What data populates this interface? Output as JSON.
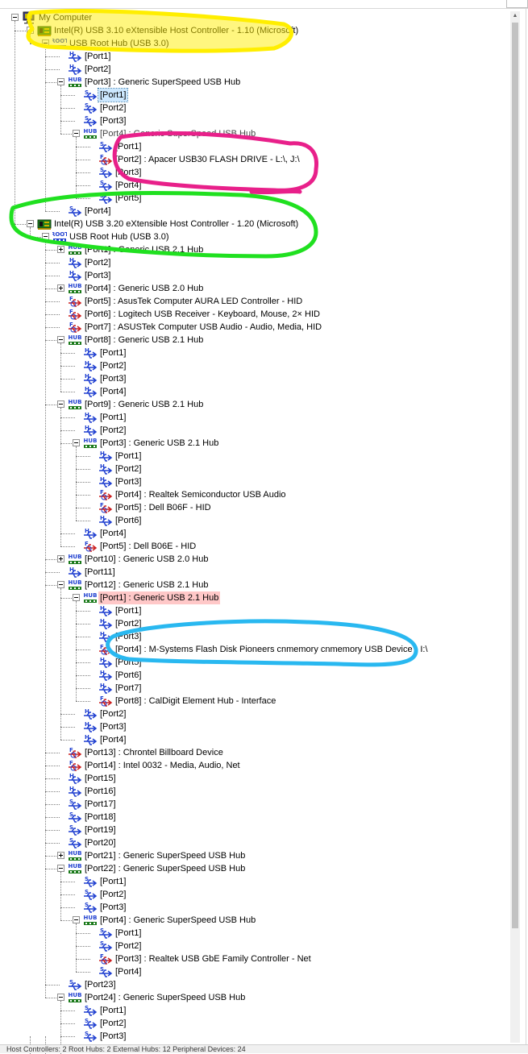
{
  "tree": [
    {
      "depth": 0,
      "exp": "minus",
      "icon": "computer",
      "label": "My Computer"
    },
    {
      "depth": 1,
      "exp": "minus",
      "icon": "controller",
      "label": "Intel(R) USB 3.10 eXtensible Host Controller - 1.10 (Microsoft)"
    },
    {
      "depth": 2,
      "exp": "minus",
      "icon": "root",
      "label": "USB Root Hub (USB 3.0)"
    },
    {
      "depth": 3,
      "icon": "usb2",
      "label": "[Port1]"
    },
    {
      "depth": 3,
      "icon": "usb2",
      "label": "[Port2]"
    },
    {
      "depth": 3,
      "exp": "minus",
      "icon": "hub",
      "label": "[Port3] : Generic SuperSpeed USB Hub"
    },
    {
      "depth": 4,
      "icon": "ss",
      "label": "[Port1]",
      "state": "selected"
    },
    {
      "depth": 4,
      "icon": "ss",
      "label": "[Port2]"
    },
    {
      "depth": 4,
      "icon": "ss",
      "label": "[Port3]"
    },
    {
      "depth": 4,
      "exp": "minus",
      "icon": "hub",
      "label": "[Port4] : Generic SuperSpeed USB Hub",
      "state": "faint"
    },
    {
      "depth": 5,
      "icon": "ss",
      "label": "[Port1]"
    },
    {
      "depth": 5,
      "icon": "dev",
      "label": "[Port2] : Apacer USB30 FLASH DRIVE - L:\\, J:\\"
    },
    {
      "depth": 5,
      "icon": "ss",
      "label": "[Port3]"
    },
    {
      "depth": 5,
      "icon": "ss",
      "label": "[Port4]"
    },
    {
      "depth": 5,
      "icon": "ss",
      "label": "[Port5]"
    },
    {
      "depth": 3,
      "icon": "ss",
      "label": "[Port4]"
    },
    {
      "depth": 1,
      "exp": "minus",
      "icon": "controller",
      "label": "Intel(R) USB 3.20 eXtensible Host Controller - 1.20 (Microsoft)"
    },
    {
      "depth": 2,
      "exp": "minus",
      "icon": "root",
      "label": "USB Root Hub (USB 3.0)"
    },
    {
      "depth": 3,
      "exp": "plus",
      "icon": "hub",
      "label": "[Port1] : Generic USB 2.1 Hub"
    },
    {
      "depth": 3,
      "icon": "usb2",
      "label": "[Port2]"
    },
    {
      "depth": 3,
      "icon": "usb2",
      "label": "[Port3]"
    },
    {
      "depth": 3,
      "exp": "plus",
      "icon": "hub",
      "label": "[Port4] : Generic USB 2.0 Hub"
    },
    {
      "depth": 3,
      "icon": "dev",
      "label": "[Port5] : AsusTek Computer AURA LED Controller - HID"
    },
    {
      "depth": 3,
      "icon": "dev",
      "label": "[Port6] : Logitech USB Receiver - Keyboard, Mouse, 2× HID"
    },
    {
      "depth": 3,
      "icon": "dev",
      "label": "[Port7] : ASUSTek Computer USB Audio - Audio, Media, HID"
    },
    {
      "depth": 3,
      "exp": "minus",
      "icon": "hub",
      "label": "[Port8] : Generic USB 2.1 Hub"
    },
    {
      "depth": 4,
      "icon": "usb2",
      "label": "[Port1]"
    },
    {
      "depth": 4,
      "icon": "usb2",
      "label": "[Port2]"
    },
    {
      "depth": 4,
      "icon": "usb2",
      "label": "[Port3]"
    },
    {
      "depth": 4,
      "icon": "usb2",
      "label": "[Port4]"
    },
    {
      "depth": 3,
      "exp": "minus",
      "icon": "hub",
      "label": "[Port9] : Generic USB 2.1 Hub"
    },
    {
      "depth": 4,
      "icon": "usb2",
      "label": "[Port1]"
    },
    {
      "depth": 4,
      "icon": "usb2",
      "label": "[Port2]"
    },
    {
      "depth": 4,
      "exp": "minus",
      "icon": "hub",
      "label": "[Port3] : Generic USB 2.1 Hub"
    },
    {
      "depth": 5,
      "icon": "usb2",
      "label": "[Port1]"
    },
    {
      "depth": 5,
      "icon": "usb2",
      "label": "[Port2]"
    },
    {
      "depth": 5,
      "icon": "usb2",
      "label": "[Port3]"
    },
    {
      "depth": 5,
      "icon": "dev",
      "label": "[Port4] : Realtek Semiconductor USB Audio"
    },
    {
      "depth": 5,
      "icon": "dev",
      "label": "[Port5] : Dell B06F - HID"
    },
    {
      "depth": 5,
      "icon": "usb2",
      "label": "[Port6]"
    },
    {
      "depth": 4,
      "icon": "usb2",
      "label": "[Port4]"
    },
    {
      "depth": 4,
      "icon": "dev",
      "label": "[Port5] : Dell B06E - HID"
    },
    {
      "depth": 3,
      "exp": "plus",
      "icon": "hub",
      "label": "[Port10] : Generic USB 2.0 Hub"
    },
    {
      "depth": 3,
      "icon": "usb2",
      "label": "[Port11]"
    },
    {
      "depth": 3,
      "exp": "minus",
      "icon": "hub",
      "label": "[Port12] : Generic USB 2.1 Hub"
    },
    {
      "depth": 4,
      "exp": "minus",
      "icon": "hub",
      "label": "[Port1] : Generic USB 2.1 Hub",
      "state": "highlight"
    },
    {
      "depth": 5,
      "icon": "usb2",
      "label": "[Port1]"
    },
    {
      "depth": 5,
      "icon": "usb2",
      "label": "[Port2]"
    },
    {
      "depth": 5,
      "icon": "usb2",
      "label": "[Port3]"
    },
    {
      "depth": 5,
      "icon": "dev",
      "label": "[Port4] : M-Systems Flash Disk Pioneers cnmemory cnmemory USB Device - I:\\"
    },
    {
      "depth": 5,
      "icon": "usb2",
      "label": "[Port5]"
    },
    {
      "depth": 5,
      "icon": "usb2",
      "label": "[Port6]"
    },
    {
      "depth": 5,
      "icon": "usb2",
      "label": "[Port7]"
    },
    {
      "depth": 5,
      "icon": "dev",
      "label": "[Port8] : CalDigit Element Hub -  Interface"
    },
    {
      "depth": 4,
      "icon": "usb2",
      "label": "[Port2]"
    },
    {
      "depth": 4,
      "icon": "usb2",
      "label": "[Port3]"
    },
    {
      "depth": 4,
      "icon": "usb2",
      "label": "[Port4]"
    },
    {
      "depth": 3,
      "icon": "dev",
      "label": "[Port13] : Chrontel Billboard Device"
    },
    {
      "depth": 3,
      "icon": "dev",
      "label": "[Port14] : Intel 0032 - Media, Audio, Net"
    },
    {
      "depth": 3,
      "icon": "usb2",
      "label": "[Port15]"
    },
    {
      "depth": 3,
      "icon": "usb2",
      "label": "[Port16]"
    },
    {
      "depth": 3,
      "icon": "ss",
      "label": "[Port17]"
    },
    {
      "depth": 3,
      "icon": "ss",
      "label": "[Port18]"
    },
    {
      "depth": 3,
      "icon": "ss",
      "label": "[Port19]"
    },
    {
      "depth": 3,
      "icon": "ss",
      "label": "[Port20]"
    },
    {
      "depth": 3,
      "exp": "plus",
      "icon": "hub",
      "label": "[Port21] : Generic SuperSpeed USB Hub"
    },
    {
      "depth": 3,
      "exp": "minus",
      "icon": "hub",
      "label": "[Port22] : Generic SuperSpeed USB Hub"
    },
    {
      "depth": 4,
      "icon": "ss",
      "label": "[Port1]"
    },
    {
      "depth": 4,
      "icon": "ss",
      "label": "[Port2]"
    },
    {
      "depth": 4,
      "icon": "ss",
      "label": "[Port3]"
    },
    {
      "depth": 4,
      "exp": "minus",
      "icon": "hub",
      "label": "[Port4] : Generic SuperSpeed USB Hub"
    },
    {
      "depth": 5,
      "icon": "ss",
      "label": "[Port1]"
    },
    {
      "depth": 5,
      "icon": "ss",
      "label": "[Port2]"
    },
    {
      "depth": 5,
      "icon": "dev",
      "label": "[Port3] : Realtek USB GbE Family Controller - Net"
    },
    {
      "depth": 5,
      "icon": "ss",
      "label": "[Port4]"
    },
    {
      "depth": 3,
      "icon": "ss",
      "label": "[Port23]"
    },
    {
      "depth": 3,
      "exp": "minus",
      "icon": "hub",
      "label": "[Port24] : Generic SuperSpeed USB Hub"
    },
    {
      "depth": 4,
      "icon": "ss",
      "label": "[Port1]"
    },
    {
      "depth": 4,
      "icon": "ss",
      "label": "[Port2]"
    },
    {
      "depth": 4,
      "icon": "ss",
      "label": "[Port3]"
    }
  ],
  "statusbar": {
    "text": "Host Controllers: 2    Root Hubs: 2    External Hubs: 12    Peripheral Devices: 24"
  },
  "colors": {
    "usb_blue": "#1f3fd0",
    "device_red": "#cc1e1e",
    "hub_green": "#1b7a1b",
    "annotation_yellow": "#ffee00",
    "annotation_magenta": "#e8208a",
    "annotation_green": "#20e020",
    "annotation_cyan": "#29b8f0",
    "selection": "#cce8ff",
    "highlight": "#ffc8c8"
  }
}
